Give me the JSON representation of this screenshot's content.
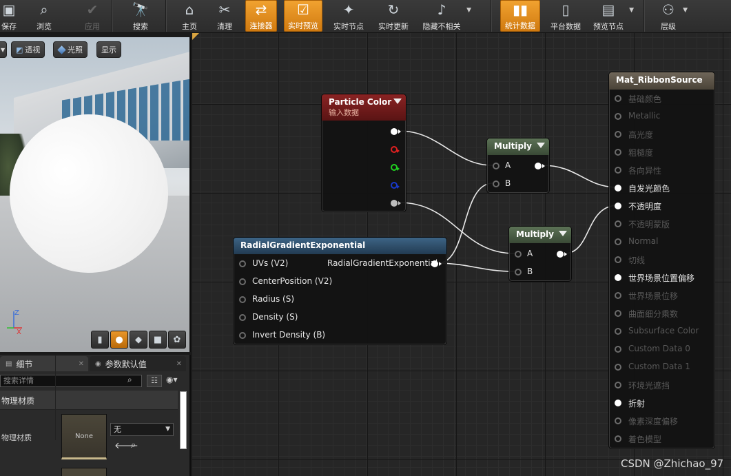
{
  "toolbar": {
    "items": [
      {
        "label": "保存",
        "icon": "save-icon"
      },
      {
        "label": "浏览",
        "icon": "browse-icon"
      },
      {
        "label": "应用",
        "icon": "apply-icon"
      },
      {
        "label": "搜索",
        "icon": "search-icon"
      },
      {
        "label": "主页",
        "icon": "home-icon"
      },
      {
        "label": "清理",
        "icon": "clean-icon"
      },
      {
        "label": "连接器",
        "icon": "connector-icon"
      },
      {
        "label": "实时预览",
        "icon": "live-preview-icon"
      },
      {
        "label": "实时节点",
        "icon": "live-nodes-icon"
      },
      {
        "label": "实时更新",
        "icon": "live-update-icon"
      },
      {
        "label": "隐藏不相关",
        "icon": "hide-unrelated-icon"
      },
      {
        "label": "统计数据",
        "icon": "stats-icon"
      },
      {
        "label": "平台数据",
        "icon": "platform-stats-icon"
      },
      {
        "label": "预览节点",
        "icon": "preview-node-icon"
      },
      {
        "label": "层级",
        "icon": "hierarchy-icon"
      }
    ],
    "disabled": [
      "应用"
    ],
    "active": [
      "连接器",
      "实时预览",
      "统计数据"
    ]
  },
  "viewport": {
    "buttons": {
      "perspective": "透视",
      "lit": "光照",
      "show": "显示"
    },
    "axis": {
      "z": "Z",
      "x": "X"
    }
  },
  "details": {
    "tab_details": "细节",
    "tab_param_defaults": "参数默认值",
    "search_placeholder": "搜索详情",
    "category": "物理材质",
    "property_label": "物理材质",
    "thumbnail_text": "None",
    "combo_value": "无"
  },
  "nodes": {
    "particle_color": {
      "title": "Particle Color",
      "subtitle": "输入数据"
    },
    "multiply1": {
      "title": "Multiply",
      "pin_a": "A",
      "pin_b": "B"
    },
    "multiply2": {
      "title": "Multiply",
      "pin_a": "A",
      "pin_b": "B"
    },
    "radial": {
      "title": "RadialGradientExponential",
      "output": "RadialGradientExponential",
      "inputs": [
        "UVs (V2)",
        "CenterPosition (V2)",
        "Radius (S)",
        "Density (S)",
        "Invert Density (B)"
      ]
    },
    "material": {
      "title": "Mat_RibbonSource",
      "inputs": [
        {
          "label": "基础颜色",
          "connected": false
        },
        {
          "label": "Metallic",
          "connected": false
        },
        {
          "label": "高光度",
          "connected": false
        },
        {
          "label": "粗糙度",
          "connected": false
        },
        {
          "label": "各向异性",
          "connected": false
        },
        {
          "label": "自发光颜色",
          "connected": true
        },
        {
          "label": "不透明度",
          "connected": true
        },
        {
          "label": "不透明蒙版",
          "connected": false
        },
        {
          "label": "Normal",
          "connected": false
        },
        {
          "label": "切线",
          "connected": false
        },
        {
          "label": "世界场景位置偏移",
          "connected": true
        },
        {
          "label": "世界场景位移",
          "connected": false
        },
        {
          "label": "曲面细分乘数",
          "connected": false
        },
        {
          "label": "Subsurface Color",
          "connected": false
        },
        {
          "label": "Custom Data 0",
          "connected": false
        },
        {
          "label": "Custom Data 1",
          "connected": false
        },
        {
          "label": "环境光遮挡",
          "connected": false
        },
        {
          "label": "折射",
          "connected": true
        },
        {
          "label": "像素深度偏移",
          "connected": false
        },
        {
          "label": "着色模型",
          "connected": false
        }
      ]
    }
  },
  "watermark": "CSDN @Zhichao_97",
  "colors": {
    "accent": "#e8962a",
    "particle_header": "#8a2323",
    "multiply_header": "#5c7256",
    "function_header": "#3d6485",
    "material_header": "#6f6659"
  }
}
